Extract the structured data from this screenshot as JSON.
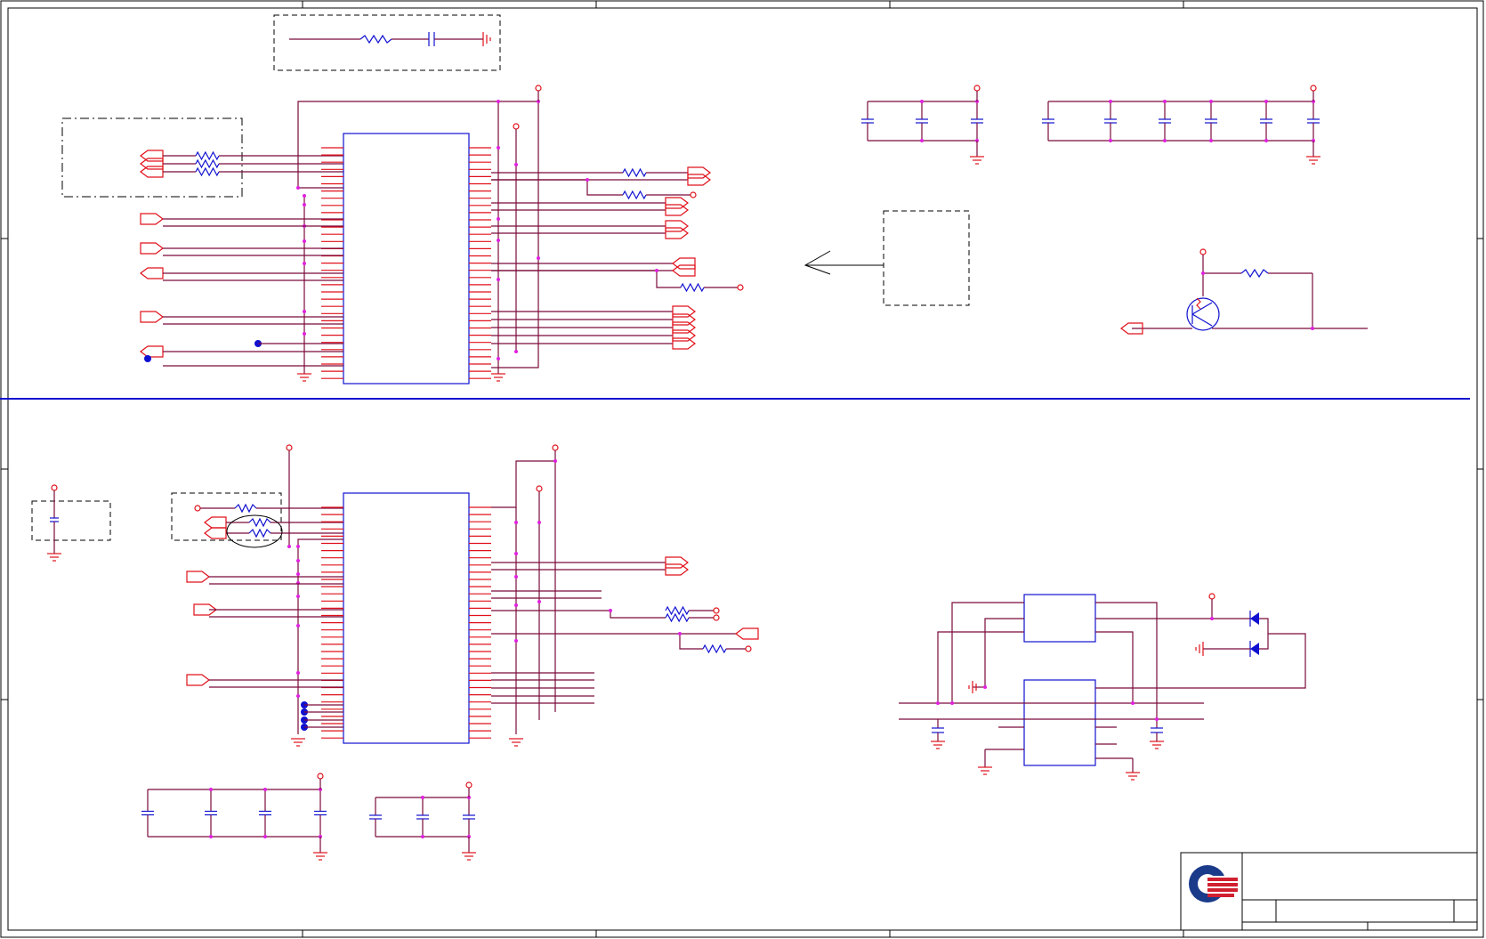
{
  "colors": {
    "wire": "#7a0a3a",
    "component": "#e0101a",
    "ic_body": "#1010d0",
    "junction": "#e020e0",
    "separator": "#1010d0",
    "frame": "#000000",
    "logo_blue": "#1a3a8a",
    "logo_red": "#d02030"
  },
  "sheet": {
    "border": "schematic-frame",
    "zones": "unlabeled"
  },
  "title_block": {
    "logo": "company-logo-icon",
    "title": "",
    "rev": "",
    "sheet_no": ""
  }
}
